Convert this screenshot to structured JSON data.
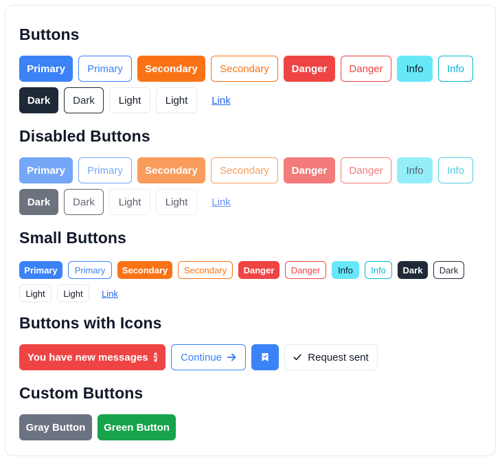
{
  "sections": {
    "buttons": {
      "title": "Buttons",
      "primary": "Primary",
      "primary_outline": "Primary",
      "secondary": "Secondary",
      "secondary_outline": "Secondary",
      "danger": "Danger",
      "danger_outline": "Danger",
      "info": "Info",
      "info_outline": "Info",
      "dark": "Dark",
      "dark_outline": "Dark",
      "light": "Light",
      "light_outline": "Light",
      "link": "Link"
    },
    "disabled": {
      "title": "Disabled Buttons",
      "primary": "Primary",
      "primary_outline": "Primary",
      "secondary": "Secondary",
      "secondary_outline": "Secondary",
      "danger": "Danger",
      "danger_outline": "Danger",
      "info": "Info",
      "info_outline": "Info",
      "dark": "Dark",
      "dark_outline": "Dark",
      "light": "Light",
      "light_outline": "Light",
      "link": "Link"
    },
    "small": {
      "title": "Small Buttons",
      "primary": "Primary",
      "primary_outline": "Primary",
      "secondary": "Secondary",
      "secondary_outline": "Secondary",
      "danger": "Danger",
      "danger_outline": "Danger",
      "info": "Info",
      "info_outline": "Info",
      "dark": "Dark",
      "dark_outline": "Dark",
      "light": "Light",
      "light_outline": "Light",
      "link": "Link"
    },
    "icons": {
      "title": "Buttons with Icons",
      "messages": "You have new messages",
      "messages_badge": "2",
      "continue": "Continue",
      "request_sent": "Request sent"
    },
    "custom": {
      "title": "Custom Buttons",
      "gray": "Gray Button",
      "green": "Green Button"
    }
  },
  "colors": {
    "primary": "#3b82f6",
    "secondary": "#f97316",
    "danger": "#ef4444",
    "info": "#67e8f9",
    "dark": "#1f2937",
    "gray": "#6b7280",
    "green": "#16a34a"
  },
  "icons": [
    "arrow-right-icon",
    "bookmark-icon",
    "check-icon"
  ]
}
